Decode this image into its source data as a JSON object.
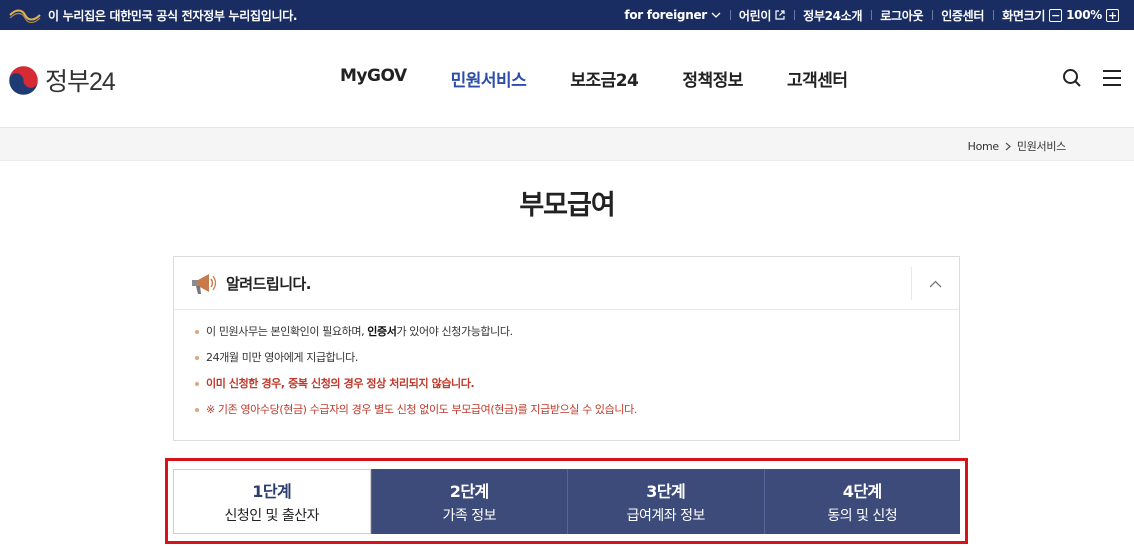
{
  "topbar": {
    "notice": "이 누리집은 대한민국 공식 전자정부 누리집입니다.",
    "links": [
      "for foreigner",
      "어린이",
      "정부24소개",
      "로그아웃",
      "인증센터",
      "화면크기"
    ],
    "zoom_minus": "−",
    "zoom_value": "100%",
    "zoom_plus": "+"
  },
  "header": {
    "logo_text": "정부24",
    "nav": [
      "MyGOV",
      "민원서비스",
      "보조금24",
      "정책정보",
      "고객센터"
    ],
    "active_nav": "민원서비스"
  },
  "breadcrumb": {
    "home": "Home",
    "current": "민원서비스"
  },
  "page_title": "부모급여",
  "notice": {
    "title": "알려드립니다.",
    "items": [
      {
        "pre": "이 민원사무는 본인확인이 필요하며, ",
        "bold": "인증서",
        "post": "가 있어야 신청가능합니다."
      },
      {
        "text": "24개월 미만 영아에게 지급합니다."
      },
      {
        "text": "이미 신청한 경우, 중복 신청의 경우 정상 처리되지 않습니다."
      },
      {
        "text": "※ 기존 영아수당(현금) 수급자의 경우 별도 신청 없이도 부모급여(현금)를 지급받으실 수 있습니다."
      }
    ]
  },
  "steps": [
    {
      "num": "1단계",
      "label": "신청인 및 출산자"
    },
    {
      "num": "2단계",
      "label": "가족 정보"
    },
    {
      "num": "3단계",
      "label": "급여계좌 정보"
    },
    {
      "num": "4단계",
      "label": "동의 및 신청"
    }
  ],
  "colors": {
    "topbar": "#1a2d63",
    "nav_active": "#2c4ea8",
    "step_bg": "#3c4b7a",
    "highlight": "#d7121b"
  }
}
